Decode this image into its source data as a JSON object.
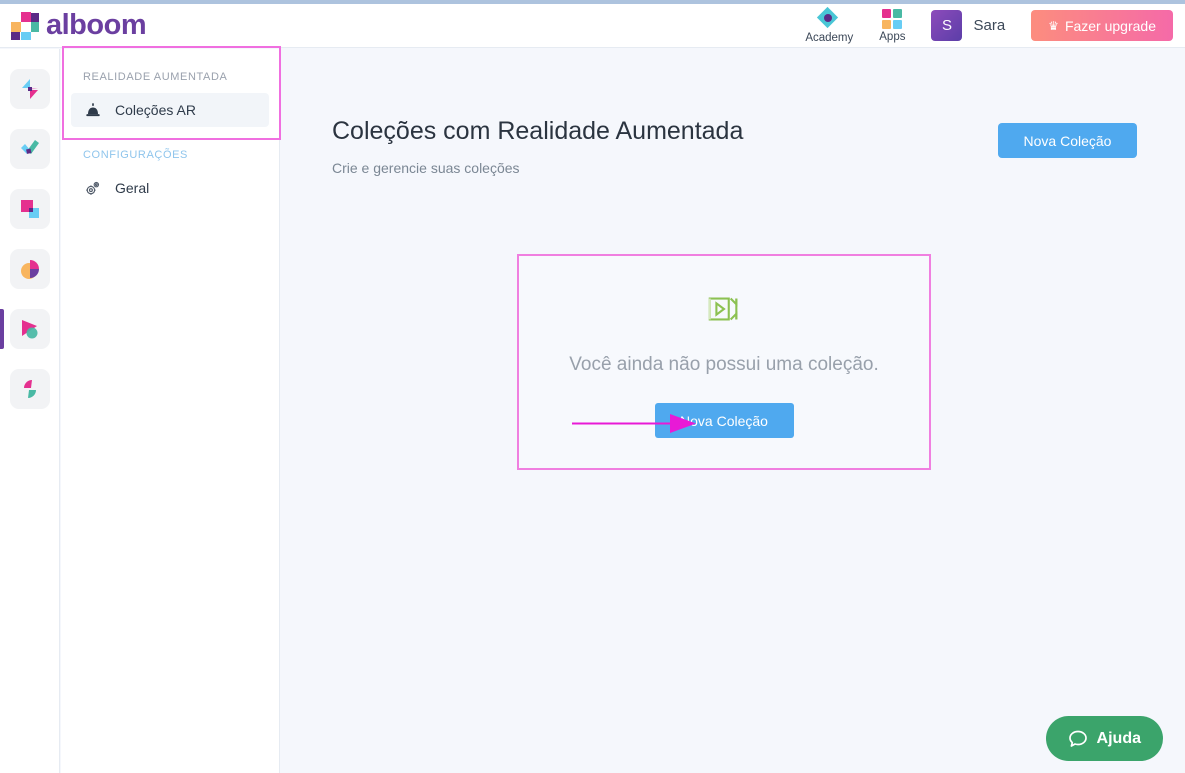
{
  "header": {
    "brand_name": "alboom",
    "brand_icon": "alboom-logo-pinwheel",
    "academy": {
      "label": "Academy",
      "icon": "diamond-icon"
    },
    "apps": {
      "label": "Apps",
      "icon": "grid-apps-icon"
    },
    "avatar_initial": "S",
    "user_name": "Sara",
    "upgrade_label": "Fazer upgrade",
    "upgrade_icon": "crown-icon",
    "upgrade_gradient_from": "#fc8d7e",
    "upgrade_gradient_to": "#f56aa8"
  },
  "rail": {
    "items": [
      {
        "name": "app-pinwheel",
        "icon": "pinwheel-icon",
        "active": false
      },
      {
        "name": "app-check",
        "icon": "check-icon",
        "active": false
      },
      {
        "name": "app-squares",
        "icon": "squares-icon",
        "active": false
      },
      {
        "name": "app-piechart",
        "icon": "pie-chart-icon",
        "active": false
      },
      {
        "name": "app-play",
        "icon": "play-icon",
        "active": true
      },
      {
        "name": "app-leaf",
        "icon": "leaf-icon",
        "active": false
      }
    ]
  },
  "sidebar": {
    "groups": [
      {
        "title": "REALIDADE AUMENTADA",
        "title_color": "#9aa1ad",
        "items": [
          {
            "label": "Coleções AR",
            "icon": "ar-object-icon",
            "selected": true
          }
        ]
      },
      {
        "title": "CONFIGURAÇÕES",
        "title_color": "#8fc5ec",
        "items": [
          {
            "label": "Geral",
            "icon": "gear-icon",
            "selected": false
          }
        ]
      }
    ]
  },
  "main": {
    "title": "Coleções com Realidade Aumentada",
    "subtitle": "Crie e gerencie suas coleções",
    "new_collection_label": "Nova Coleção",
    "new_collection_color": "#4fa9ef",
    "empty_state": {
      "icon": "video-camera-icon",
      "icon_color": "#8cc152",
      "message": "Você ainda não possui uma coleção.",
      "button_label": "Nova Coleção"
    }
  },
  "help": {
    "label": "Ajuda",
    "icon": "chat-bubble-icon",
    "color": "#3ba46b"
  },
  "annotations": {
    "highlight_color": "#f06fe0",
    "arrow_color": "#e81ad6"
  }
}
